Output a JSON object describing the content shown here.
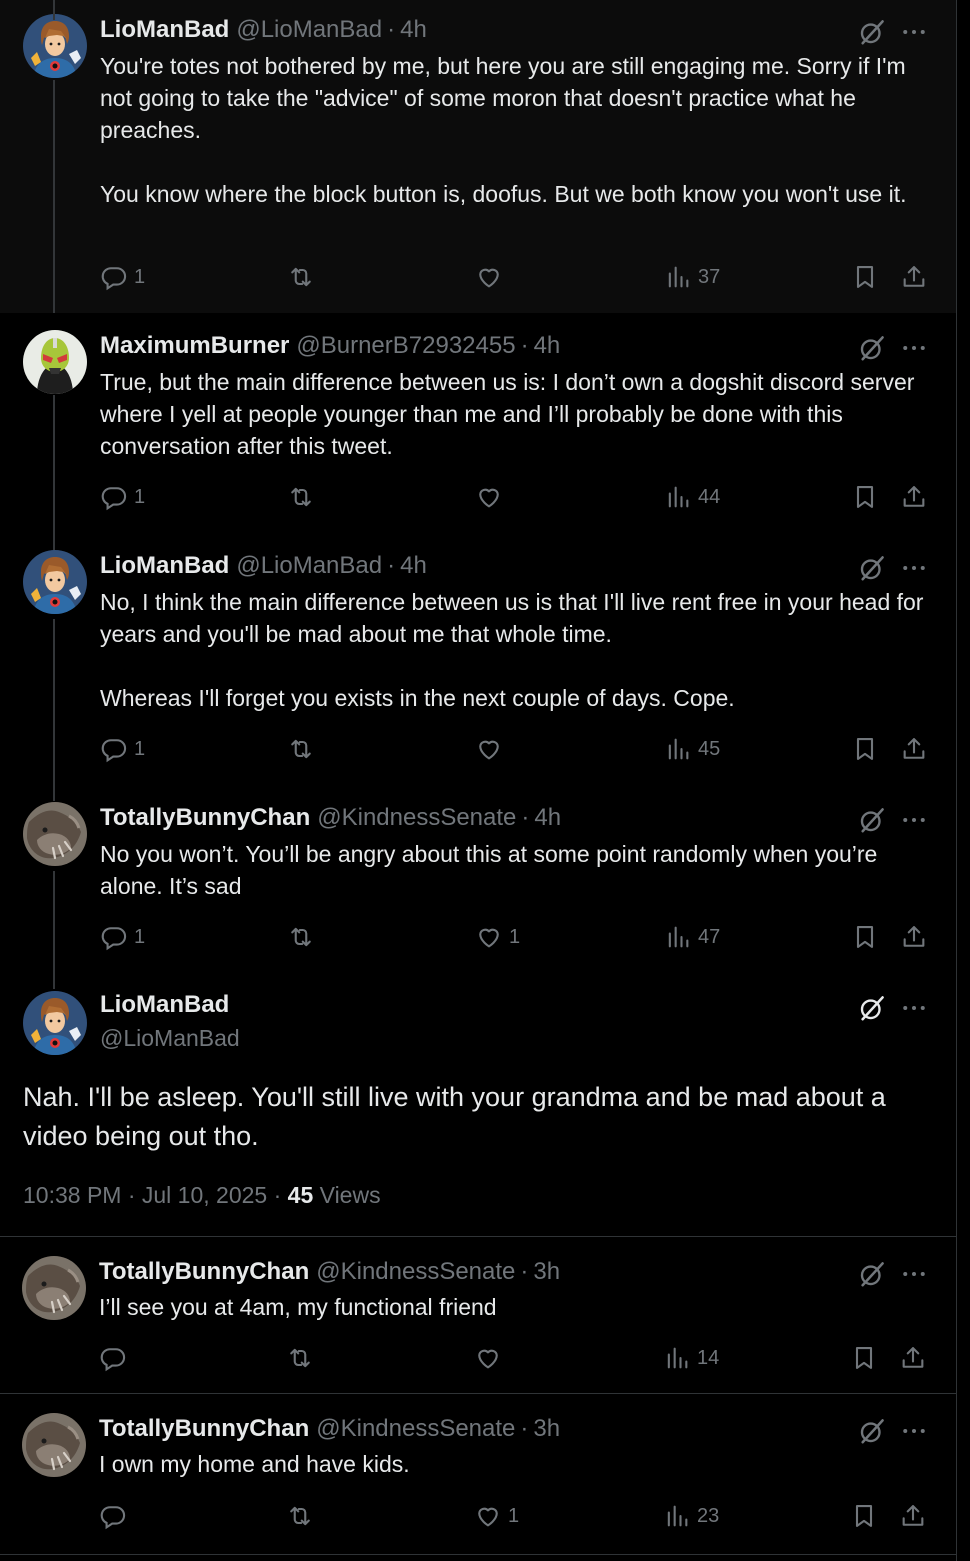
{
  "tweets": [
    {
      "name": "LioManBad",
      "handle": "@LioManBad",
      "time": "4h",
      "text": "You're totes not bothered by me, but here you are still engaging me. Sorry if I'm not going to take the \"advice\" of some moron that doesn't practice what he preaches.\n\nYou know where the block button is, doofus. But we both know you won't use it.",
      "replies": "1",
      "reposts": "",
      "likes": "",
      "views": "37",
      "avatar": "lioman"
    },
    {
      "name": "MaximumBurner",
      "handle": "@BurnerB72932455",
      "time": "4h",
      "text": "True, but the main difference between us is: I don’t own a dogshit discord server where I yell at people younger than me and I’ll probably be done with this conversation after this tweet.",
      "replies": "1",
      "reposts": "",
      "likes": "",
      "views": "44",
      "avatar": "burner"
    },
    {
      "name": "LioManBad",
      "handle": "@LioManBad",
      "time": "4h",
      "text": "No, I think the main difference between us is that I'll live rent free in your head for years and you'll be mad about me that whole time.\n\nWhereas I'll forget you exists in the next couple of days. Cope.",
      "replies": "1",
      "reposts": "",
      "likes": "",
      "views": "45",
      "avatar": "lioman"
    },
    {
      "name": "TotallyBunnyChan",
      "handle": "@KindnessSenate",
      "time": "4h",
      "text": "No you won’t. You’ll be angry about this at some point randomly when you’re alone. It’s sad",
      "replies": "1",
      "reposts": "",
      "likes": "1",
      "views": "47",
      "avatar": "bunny"
    }
  ],
  "focal": {
    "name": "LioManBad",
    "handle": "@LioManBad",
    "text": "Nah. I'll be asleep. You'll still live with your grandma and be mad about a video being out tho.",
    "datetime": "10:38 PM · Jul 10, 2025 · ",
    "views_count": "45",
    "views_label": " Views"
  },
  "replies": [
    {
      "name": "TotallyBunnyChan",
      "handle": "@KindnessSenate",
      "time": "3h",
      "text": "I’ll see you at 4am, my functional friend",
      "replies": "",
      "reposts": "",
      "likes": "",
      "views": "14",
      "avatar": "bunny"
    },
    {
      "name": "TotallyBunnyChan",
      "handle": "@KindnessSenate",
      "time": "3h",
      "text": "I own my home and have kids.",
      "replies": "",
      "reposts": "",
      "likes": "1",
      "views": "23",
      "avatar": "bunny"
    }
  ],
  "separator_dot": "·",
  "icons": {
    "reply": "reply-icon",
    "repost": "repost-icon",
    "like": "heart-icon",
    "views": "views-chart-icon",
    "bookmark": "bookmark-icon",
    "share": "share-icon",
    "grok": "grok-icon",
    "more": "more-icon"
  },
  "colors": {
    "background": "#000000",
    "text": "#e7e9ea",
    "muted": "#71767b",
    "divider": "#2f3336"
  }
}
